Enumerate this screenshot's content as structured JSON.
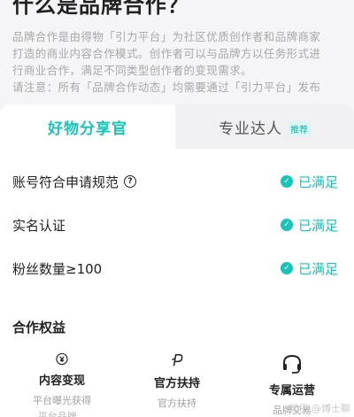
{
  "header": {
    "title": "什么是品牌合作？",
    "intro_lines": [
      "品牌合作是由得物「引力平台」为社区优质创作者和品牌商家",
      "打造的商业内容合作模式。创作者可以与品牌方以任务形式进",
      "行商业合作，满足不同类型创作者的变现需求。",
      "请注意：所有「品牌合作动态」均需要通过「引力平台」发布"
    ]
  },
  "tabs": {
    "active": "好物分享官",
    "inactive": "专业达人",
    "badge": "推荐"
  },
  "requirements": [
    {
      "label": "账号符合申请规范",
      "status": "已满足",
      "has_help": true
    },
    {
      "label": "实名认证",
      "status": "已满足",
      "has_help": false
    },
    {
      "label": "粉丝数量≥100",
      "status": "已满足",
      "has_help": false
    }
  ],
  "benefits_section": {
    "title": "合作权益",
    "items": [
      {
        "icon": "yen-circle-icon",
        "title": "内容变现",
        "desc": "平台曝光获得",
        "desc2": "平台品牌..."
      },
      {
        "icon": "p-sign-icon",
        "title": "官方扶持",
        "desc": "官方扶持",
        "desc2": "..."
      },
      {
        "icon": "headset-icon",
        "title": "专属运营",
        "desc": "品牌交易",
        "desc2": ""
      }
    ]
  },
  "watermark": "知乎 @博士聊",
  "colors": {
    "accent": "#16c5b7",
    "background": "#f5f5f7"
  }
}
